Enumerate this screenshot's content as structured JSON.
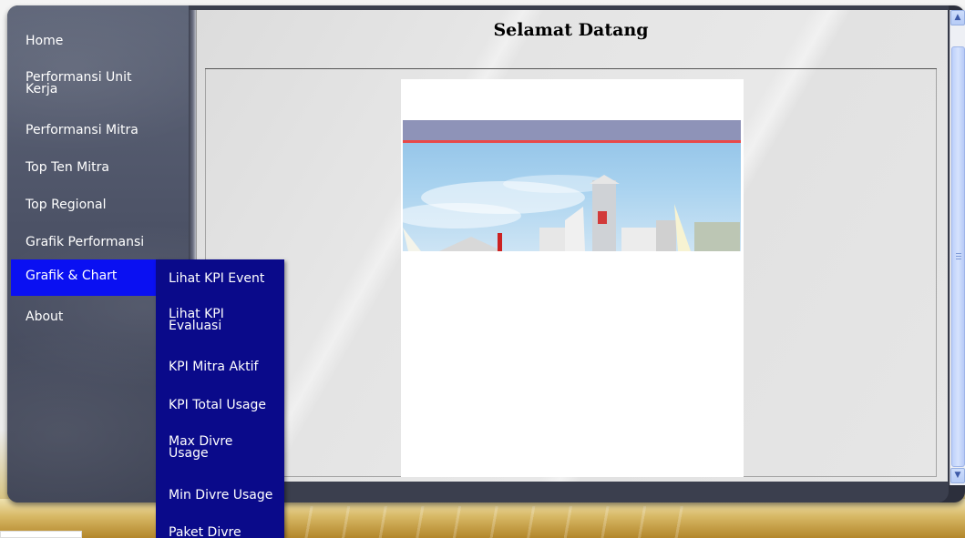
{
  "sidebar": {
    "items": [
      {
        "label": "Home"
      },
      {
        "label": "Performansi Unit\nKerja"
      },
      {
        "label": "Performansi Mitra"
      },
      {
        "label": "Top Ten Mitra"
      },
      {
        "label": "Top Regional"
      },
      {
        "label": "Grafik Performansi"
      },
      {
        "label": "Grafik & Chart",
        "active": true
      },
      {
        "label": "About"
      }
    ]
  },
  "submenu": {
    "items": [
      {
        "label": "Lihat KPI Event"
      },
      {
        "label": "Lihat KPI\nEvaluasi"
      },
      {
        "label": "KPI Mitra Aktif"
      },
      {
        "label": "KPI Total Usage"
      },
      {
        "label": "Max Divre\nUsage"
      },
      {
        "label": "Min Divre Usage"
      },
      {
        "label": "Paket Divre"
      }
    ]
  },
  "main": {
    "title": "Selamat Datang"
  },
  "colors": {
    "active_menu": "#0a10f2",
    "submenu_bg": "#0a0a8a",
    "sidebar_bg": "#4c5266"
  },
  "icons": {
    "scroll_up": "chevron-up-icon",
    "scroll_down": "chevron-down-icon"
  }
}
